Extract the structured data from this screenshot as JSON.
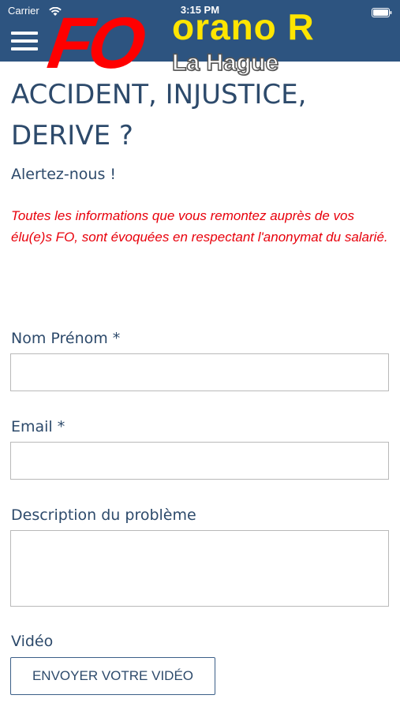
{
  "status_bar": {
    "carrier": "Carrier",
    "time": "3:15 PM"
  },
  "header": {
    "logo_text": "FO",
    "brand_text": "orano R",
    "brand_subtext": "La Hague",
    "menu_icon": "hamburger-menu-icon",
    "colors": {
      "header_bg": "#2d5480",
      "logo_red": "#ff0000",
      "brand_yellow": "#ffe500"
    }
  },
  "page": {
    "title": "ACCIDENT, INJUSTICE, DERIVE ?",
    "subtitle": "Alertez-nous !",
    "notice": "Toutes les informations que vous remontez auprès de vos élu(e)s FO, sont évoquées en respectant l'anonymat du salarié."
  },
  "form": {
    "name_label": "Nom Prénom *",
    "name_value": "",
    "email_label": "Email *",
    "email_value": "",
    "description_label": "Description du problème",
    "description_value": "",
    "video_label": "Vidéo",
    "video_button": "ENVOYER VOTRE VIDÉO"
  }
}
